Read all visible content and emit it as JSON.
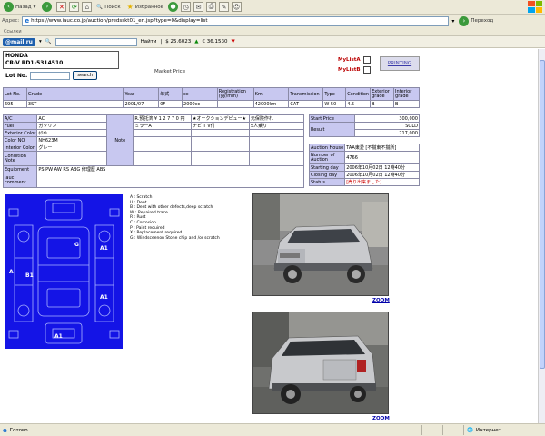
{
  "browser": {
    "back_label": "Назад",
    "search_label": "Поиск",
    "favorites_label": "Избранное",
    "address_label": "Адрес:",
    "url": "https://www.iauc.co.jp/auction/predsskt01_en.jsp?type=0&display=list",
    "go_label": "Переход",
    "links_label": "Ссылки",
    "mailru": "@mail.ru",
    "find_label": "Найти",
    "usd_rate": "$ 25.6023",
    "eur_rate": "€ 36.1530",
    "status_left": "Готово",
    "status_zone": "Интернет"
  },
  "car": {
    "make": "HONDA",
    "model_line": "CR-V   RD1-5314510"
  },
  "lot": {
    "label": "Lot No.",
    "search_btn": "search"
  },
  "market_price": "Market Price",
  "mylist_a": "MyListA",
  "mylist_b": "MyListB",
  "printing": "PRINTING",
  "main_table": {
    "headers": [
      "Lot No.",
      "Grade",
      "Year",
      "年式",
      "cc",
      "Registration (yy/mm)",
      "Km",
      "Transmission",
      "Type",
      "Condition",
      "Exterior grade",
      "Interior grade"
    ],
    "row": [
      "695",
      "3ST",
      "2001/07",
      "0F",
      "2000cc",
      "",
      "42000km",
      "CAT",
      "W 50",
      "4.5",
      "B",
      "B"
    ]
  },
  "details": {
    "rows": [
      {
        "label": "A/C",
        "value": "AC"
      },
      {
        "label": "Fuel",
        "value": "ガソリン"
      },
      {
        "label": "Exterior Color",
        "value": "ﾎﾜｲﾄ"
      },
      {
        "label": "Color NO",
        "value": "NH623M"
      },
      {
        "label": "Interior Color",
        "value": "グレー"
      },
      {
        "label": "Condition Note",
        "value": ""
      },
      {
        "label": "Equipment",
        "value": "PS PW AW RS ABG 修理歴 ABS"
      },
      {
        "label": "iauc comment",
        "value": ""
      }
    ],
    "note_label": "Note",
    "note_lines": [
      [
        "R.預託済 ¥ 1 2 7 7 0 円",
        "★オークションデビュー★",
        "元保険作れ"
      ],
      [
        "ミラーA",
        "ナビ T V付",
        "5人乗り"
      ]
    ]
  },
  "price": {
    "start_label": "Start Price",
    "start_value": "300,000",
    "result_label": "Result",
    "result_status": "SOLD",
    "result_value": "717,000"
  },
  "auction": {
    "house_label": "Auction House",
    "house_value": "TAA東愛 [不揃東不揃所]",
    "number_label": "Number of Auction",
    "number_value": "4766",
    "starting_label": "Starting day",
    "starting_value": "2006年10月02日 12時40分",
    "closing_label": "Closing day",
    "closing_value": "2006年10月02日 12時40分",
    "status_label": "Status",
    "status_value": "[売り出来ました]"
  },
  "legend": [
    "A : Scratch",
    "U : Dent",
    "B : Dent with other defects,deep scratch",
    "W : Repaired trace",
    "R : Rust",
    "C : Corrosion",
    "P : Paint required",
    "X : Replacement required",
    "G : Windsceenon Stone chip and /or scratch"
  ],
  "diagram_marks": [
    "G",
    "A1",
    "A",
    "B1",
    "A1",
    "A1"
  ],
  "zoom_label": "ZOOM",
  "colors": {
    "header_bg": "#c8c8f0",
    "diagram_bg": "#1414e6",
    "status_red": "#cc0000"
  }
}
